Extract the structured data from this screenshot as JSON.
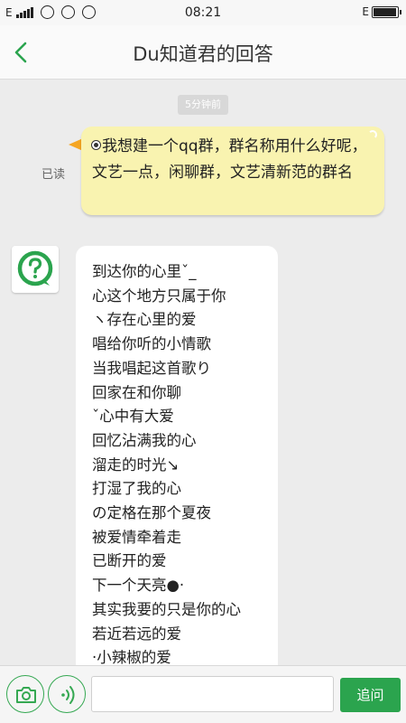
{
  "status_bar": {
    "network": "E",
    "time": "08:21",
    "network_right": "E"
  },
  "header": {
    "title": "Du知道君的回答"
  },
  "conversation": {
    "timestamp": "5分钟前",
    "read_status": "已读",
    "question": "我想建一个qq群，群名称用什么好呢，文艺一点，闲聊群，文艺清新范的群名",
    "answer_lines": [
      "到达你的心里ˇ_",
      "心这个地方只属于你",
      "ヽ存在心里的爱",
      "唱给你听的小情歌",
      "当我唱起这首歌り",
      "回家在和你聊",
      "ˇ心中有大爱",
      "回忆沾满我的心",
      "溜走的时光↘",
      "打湿了我的心",
      "の定格在那个夏夜",
      "被爱情牵着走",
      "已断开的爱",
      "下一个天亮●·",
      "其实我要的只是你的心",
      "若近若远的爱",
      "·小辣椒的爱"
    ]
  },
  "input_bar": {
    "placeholder": "",
    "send_label": "追问"
  },
  "colors": {
    "accent": "#2ba44e",
    "question_bubble": "#f9f3b0"
  },
  "icons": [
    "back-arrow-icon",
    "camera-icon",
    "voice-icon",
    "question-mark-icon",
    "battery-icon",
    "signal-icon"
  ]
}
